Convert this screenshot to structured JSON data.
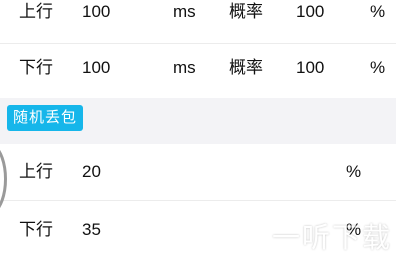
{
  "delay": {
    "rows": [
      {
        "label": "上行",
        "value": "100",
        "unit": "ms",
        "prob_label": "概率",
        "prob_value": "100",
        "prob_unit": "%"
      },
      {
        "label": "下行",
        "value": "100",
        "unit": "ms",
        "prob_label": "概率",
        "prob_value": "100",
        "prob_unit": "%"
      }
    ]
  },
  "packet_loss": {
    "section_label": "随机丢包",
    "rows": [
      {
        "label": "上行",
        "value": "20",
        "unit": "%"
      },
      {
        "label": "下行",
        "value": "35",
        "unit": "%"
      }
    ]
  },
  "watermark": {
    "text": "一听下载",
    "icon": "yiting-logo-icon"
  },
  "colors": {
    "section_tag_bg": "#16b6ea",
    "section_band_bg": "#f3f3f6"
  }
}
